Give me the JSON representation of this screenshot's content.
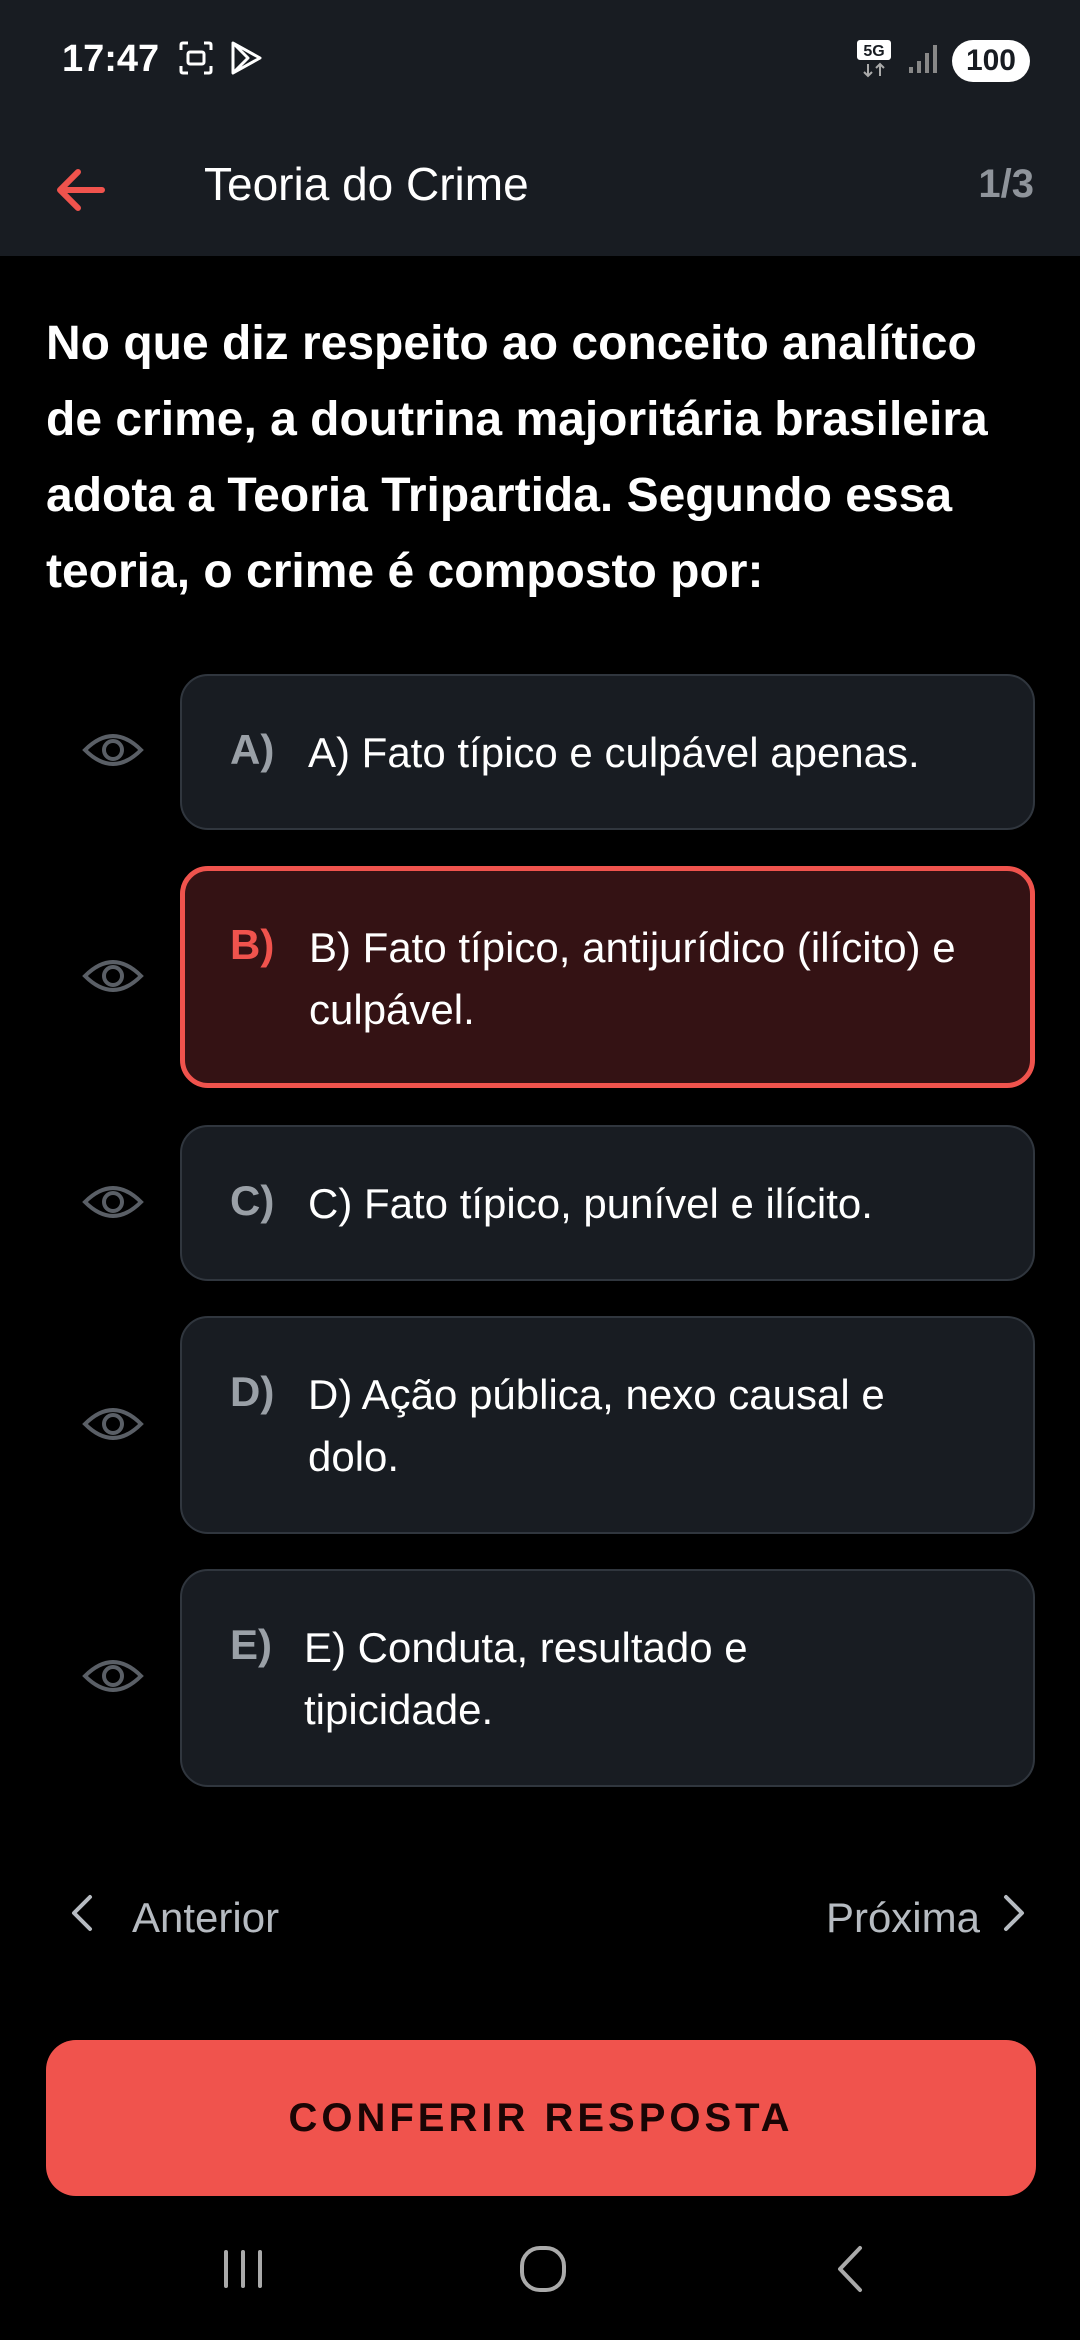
{
  "status_bar": {
    "time": "17:47",
    "network": "5G",
    "battery": "100"
  },
  "header": {
    "title": "Teoria do Crime",
    "counter": "1/3"
  },
  "question": "No que diz respeito ao conceito analítico de crime, a doutrina majoritária brasileira adota a Teoria Tripartida. Segundo essa teoria, o crime é composto por:",
  "options": [
    {
      "letter": "A)",
      "text": "A) Fato típico e culpável apenas.",
      "selected": false
    },
    {
      "letter": "B)",
      "text": "B) Fato típico, antijurídico (ilícito) e culpável.",
      "selected": true
    },
    {
      "letter": "C)",
      "text": "C) Fato típico, punível e ilícito.",
      "selected": false
    },
    {
      "letter": "D)",
      "text": "D) Ação pública, nexo causal e dolo.",
      "selected": false
    },
    {
      "letter": "E)",
      "text": "E) Conduta, resultado e tipicidade.",
      "selected": false
    }
  ],
  "navigation": {
    "prev_label": "Anterior",
    "next_label": "Próxima"
  },
  "confirm_button": "CONFERIR RESPOSTA",
  "colors": {
    "accent": "#f0534d",
    "surface": "#181c22",
    "selected_surface": "#341214",
    "background": "#000000"
  },
  "icons": {
    "back": "arrow-left-icon",
    "eye": "eye-icon",
    "prev": "chevron-left-icon",
    "next": "chevron-right-icon"
  }
}
